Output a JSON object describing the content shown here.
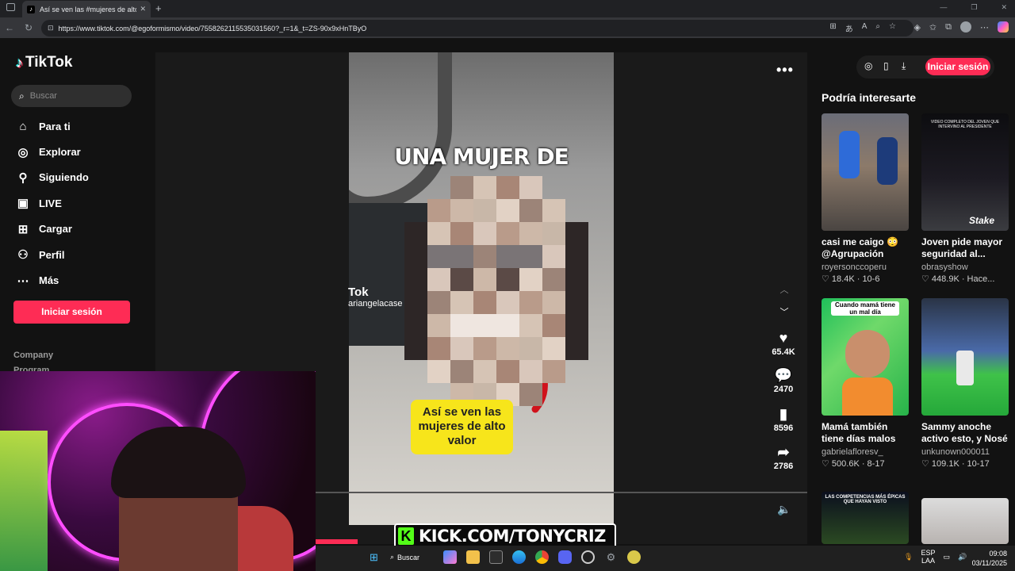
{
  "browser": {
    "tab_title": "Así se ven las #mujeres de alto va",
    "url": "https://www.tiktok.com/@egoformismo/video/7558262115535031560?_r=1&_t=ZS-90x9xHnTByO"
  },
  "sidebar": {
    "logo": "TikTok",
    "search_placeholder": "Buscar",
    "items": [
      {
        "label": "Para ti",
        "icon": "home-icon"
      },
      {
        "label": "Explorar",
        "icon": "compass-icon"
      },
      {
        "label": "Siguiendo",
        "icon": "following-icon"
      },
      {
        "label": "LIVE",
        "icon": "live-icon"
      },
      {
        "label": "Cargar",
        "icon": "upload-icon"
      },
      {
        "label": "Perfil",
        "icon": "profile-icon"
      },
      {
        "label": "Más",
        "icon": "more-dots-icon"
      }
    ],
    "login_label": "Iniciar sesión",
    "footer": [
      "Company",
      "Program"
    ]
  },
  "video": {
    "caption_top": "UNA MUJER DE",
    "watermark": "Tok",
    "watermark_user": "ariangelacase",
    "yellow_text": "Así se ven las mujeres de alto valor",
    "likes": "65.4K",
    "comments": "2470",
    "saves": "8596",
    "shares": "2786",
    "progress_fraction": 0.085
  },
  "header": {
    "login_label": "Iniciar sesión"
  },
  "suggestions": {
    "title": "Podría interesarte",
    "cards": [
      {
        "caption": "casi me caigo 😳 @Agrupación Furia...",
        "user": "royersonccoperu",
        "stats": "♡ 18.4K · 10-6"
      },
      {
        "caption": "Joven pide mayor seguridad al...",
        "user": "obrasyshow",
        "stats": "♡ 448.9K · Hace..."
      },
      {
        "caption": "Mamá también tiene días malos 💝 #fyp...",
        "user": "gabrielafloresv_",
        "stats": "♡ 500.6K · 8-17"
      },
      {
        "caption": "Sammy anoche activo esto, y Nosé ...",
        "user": "unkunown000011",
        "stats": "♡ 109.1K · 10-17"
      }
    ],
    "thumb_texts": [
      "VIDEO COMPLETO DEL JOVEN QUE INTERVINO AL PRESIDENTE",
      "Stake",
      "Cuando mamá tiene un mal día",
      "LAS COMPETENCIAS MÁS ÉPICAS QUE HAYAN VISTO"
    ]
  },
  "overlay": {
    "kick_text": "KICK.COM/TONYCRIZ"
  },
  "taskbar": {
    "search_label": "Buscar",
    "lang": "ESP",
    "lang2": "LAA",
    "time": "09:08",
    "date": "03/11/2025"
  }
}
